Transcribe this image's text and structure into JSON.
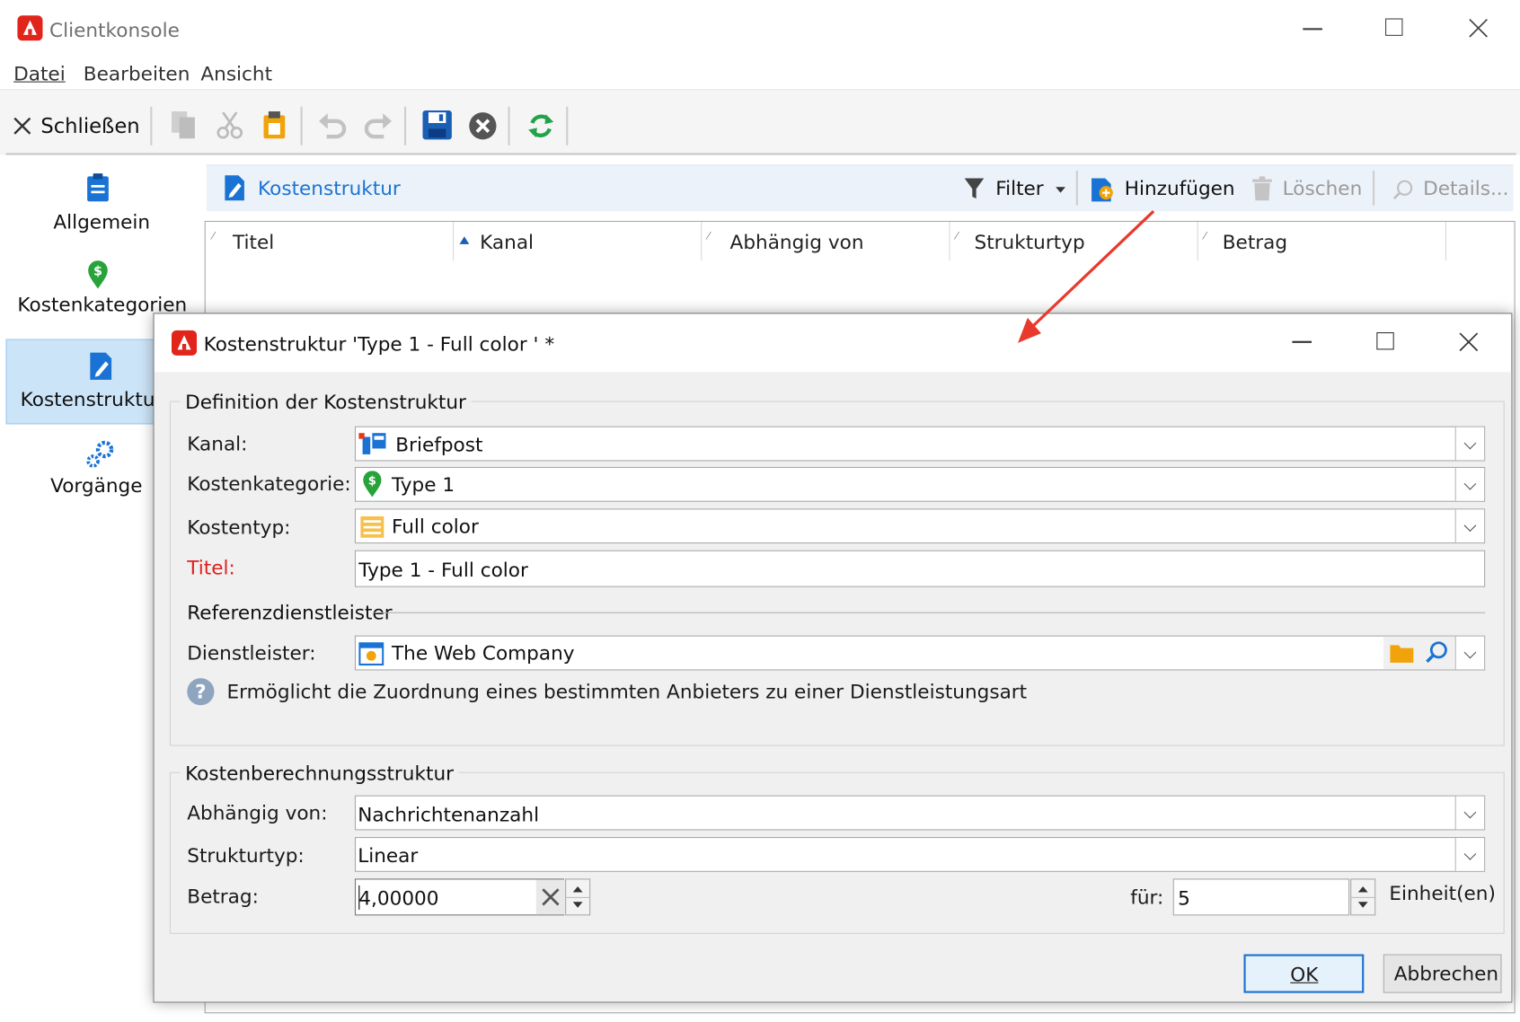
{
  "window": {
    "title": "Clientkonsole"
  },
  "menu": [
    "Datei",
    "Bearbeiten",
    "Ansicht"
  ],
  "toolbar": {
    "close_label": "Schließen"
  },
  "sidebar": {
    "items": [
      {
        "label": "Allgemein"
      },
      {
        "label": "Kostenkategorien"
      },
      {
        "label": "Kostenstruktur"
      },
      {
        "label": "Vorgänge"
      }
    ]
  },
  "panel": {
    "title": "Kostenstruktur",
    "filter_label": "Filter",
    "add_label": "Hinzufügen",
    "delete_label": "Löschen",
    "details_label": "Details...",
    "columns": [
      "Titel",
      "Kanal",
      "Abhängig von",
      "Strukturtyp",
      "Betrag"
    ]
  },
  "dialog": {
    "title": "Kostenstruktur 'Type 1 - Full color ' *",
    "definition_legend": "Definition der Kostenstruktur",
    "kanal_label": "Kanal:",
    "kanal_value": "Briefpost",
    "kostenkategorie_label": "Kostenkategorie:",
    "kostenkategorie_value": "Type 1",
    "kostentyp_label": "Kostentyp:",
    "kostentyp_value": "Full color",
    "titel_label": "Titel:",
    "titel_value": "Type 1 - Full color",
    "referenz_legend": "Referenzdienstleister",
    "dienstleister_label": "Dienstleister:",
    "dienstleister_value": "The Web Company",
    "help_text": "Ermöglicht die Zuordnung eines bestimmten Anbieters zu einer Dienstleistungsart",
    "calc_legend": "Kostenberechnungsstruktur",
    "abhaengig_label": "Abhängig von:",
    "abhaengig_value": "Nachrichtenanzahl",
    "strukturtyp_label": "Strukturtyp:",
    "strukturtyp_value": "Linear",
    "betrag_label": "Betrag:",
    "betrag_value": "4,00000",
    "fuer_label": "für:",
    "fuer_value": "5",
    "einheit_label": "Einheit(en)",
    "ok_label": "OK",
    "cancel_label": "Abbrechen"
  },
  "colors": {
    "accent": "#1a73d4",
    "title_required": "#e02020",
    "arrow": "#e8392c",
    "brand": "#e1251b"
  }
}
